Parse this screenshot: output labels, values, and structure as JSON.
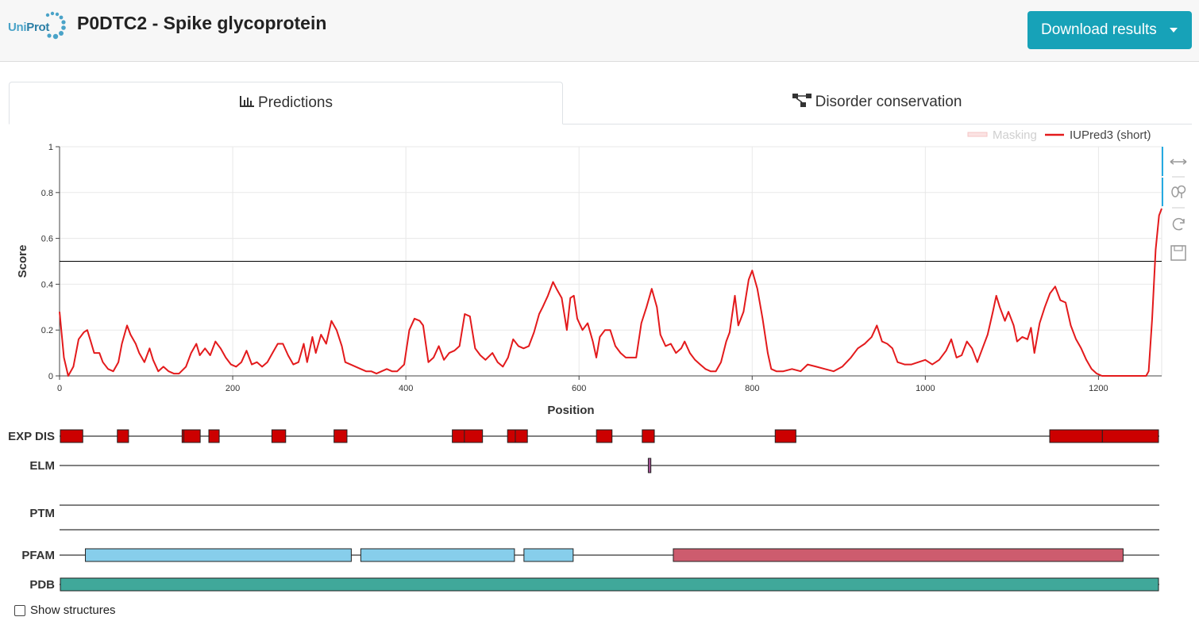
{
  "header": {
    "logo_text_a": "Uni",
    "logo_text_b": "Prot",
    "title": "P0DTC2 - Spike glycoprotein",
    "download_label": "Download results"
  },
  "tabs": [
    {
      "label": "Predictions",
      "icon": "bar-chart-icon",
      "active": true
    },
    {
      "label": "Disorder conservation",
      "icon": "tree-icon",
      "active": false
    }
  ],
  "toolbar": {
    "tools": [
      "pan-icon",
      "wheel-zoom-icon",
      "reset-icon",
      "save-icon"
    ]
  },
  "chart_data": {
    "type": "line",
    "xlabel": "Position",
    "ylabel": "Score",
    "xlim": [
      0,
      1273
    ],
    "ylim": [
      0,
      1
    ],
    "x_ticks": [
      0,
      200,
      400,
      600,
      800,
      1000,
      1200
    ],
    "y_ticks": [
      "0",
      "0.2",
      "0.4",
      "0.6",
      "0.8",
      "1"
    ],
    "threshold": 0.5,
    "legend": [
      {
        "name": "Masking",
        "color": "#f4b8b8",
        "muted": true
      },
      {
        "name": "IUPred3 (short)",
        "color": "#e31a1c",
        "muted": false
      }
    ],
    "series": [
      {
        "name": "IUPred3 (short)",
        "color": "#e31a1c",
        "points": [
          [
            0,
            0.28
          ],
          [
            5,
            0.08
          ],
          [
            10,
            0
          ],
          [
            16,
            0.04
          ],
          [
            22,
            0.16
          ],
          [
            28,
            0.19
          ],
          [
            32,
            0.2
          ],
          [
            36,
            0.15
          ],
          [
            40,
            0.1
          ],
          [
            46,
            0.1
          ],
          [
            50,
            0.06
          ],
          [
            56,
            0.03
          ],
          [
            62,
            0.02
          ],
          [
            68,
            0.06
          ],
          [
            72,
            0.14
          ],
          [
            78,
            0.22
          ],
          [
            82,
            0.18
          ],
          [
            88,
            0.14
          ],
          [
            92,
            0.1
          ],
          [
            98,
            0.06
          ],
          [
            104,
            0.12
          ],
          [
            108,
            0.07
          ],
          [
            114,
            0.02
          ],
          [
            120,
            0.04
          ],
          [
            126,
            0.02
          ],
          [
            132,
            0.01
          ],
          [
            138,
            0.01
          ],
          [
            146,
            0.04
          ],
          [
            152,
            0.1
          ],
          [
            158,
            0.14
          ],
          [
            162,
            0.09
          ],
          [
            168,
            0.12
          ],
          [
            174,
            0.09
          ],
          [
            180,
            0.15
          ],
          [
            186,
            0.12
          ],
          [
            192,
            0.08
          ],
          [
            198,
            0.05
          ],
          [
            204,
            0.04
          ],
          [
            210,
            0.06
          ],
          [
            216,
            0.11
          ],
          [
            222,
            0.05
          ],
          [
            228,
            0.06
          ],
          [
            234,
            0.04
          ],
          [
            240,
            0.06
          ],
          [
            246,
            0.1
          ],
          [
            252,
            0.14
          ],
          [
            258,
            0.14
          ],
          [
            264,
            0.09
          ],
          [
            270,
            0.05
          ],
          [
            276,
            0.06
          ],
          [
            282,
            0.14
          ],
          [
            286,
            0.06
          ],
          [
            292,
            0.17
          ],
          [
            296,
            0.1
          ],
          [
            302,
            0.18
          ],
          [
            308,
            0.14
          ],
          [
            314,
            0.24
          ],
          [
            320,
            0.2
          ],
          [
            326,
            0.13
          ],
          [
            330,
            0.06
          ],
          [
            336,
            0.05
          ],
          [
            342,
            0.04
          ],
          [
            348,
            0.03
          ],
          [
            354,
            0.02
          ],
          [
            360,
            0.02
          ],
          [
            366,
            0.01
          ],
          [
            372,
            0.02
          ],
          [
            378,
            0.03
          ],
          [
            384,
            0.02
          ],
          [
            390,
            0.02
          ],
          [
            398,
            0.05
          ],
          [
            404,
            0.2
          ],
          [
            410,
            0.25
          ],
          [
            416,
            0.24
          ],
          [
            420,
            0.22
          ],
          [
            426,
            0.06
          ],
          [
            432,
            0.08
          ],
          [
            438,
            0.13
          ],
          [
            444,
            0.07
          ],
          [
            450,
            0.1
          ],
          [
            456,
            0.11
          ],
          [
            462,
            0.13
          ],
          [
            468,
            0.27
          ],
          [
            474,
            0.26
          ],
          [
            480,
            0.12
          ],
          [
            486,
            0.09
          ],
          [
            492,
            0.07
          ],
          [
            500,
            0.1
          ],
          [
            506,
            0.06
          ],
          [
            512,
            0.04
          ],
          [
            518,
            0.08
          ],
          [
            524,
            0.16
          ],
          [
            530,
            0.13
          ],
          [
            536,
            0.12
          ],
          [
            542,
            0.13
          ],
          [
            548,
            0.19
          ],
          [
            554,
            0.27
          ],
          [
            558,
            0.3
          ],
          [
            564,
            0.35
          ],
          [
            570,
            0.41
          ],
          [
            574,
            0.38
          ],
          [
            580,
            0.34
          ],
          [
            586,
            0.2
          ],
          [
            590,
            0.34
          ],
          [
            594,
            0.35
          ],
          [
            598,
            0.25
          ],
          [
            604,
            0.2
          ],
          [
            610,
            0.23
          ],
          [
            616,
            0.15
          ],
          [
            620,
            0.08
          ],
          [
            624,
            0.17
          ],
          [
            630,
            0.2
          ],
          [
            636,
            0.2
          ],
          [
            642,
            0.13
          ],
          [
            648,
            0.1
          ],
          [
            654,
            0.08
          ],
          [
            660,
            0.08
          ],
          [
            666,
            0.08
          ],
          [
            672,
            0.23
          ],
          [
            678,
            0.3
          ],
          [
            684,
            0.38
          ],
          [
            690,
            0.3
          ],
          [
            694,
            0.18
          ],
          [
            700,
            0.13
          ],
          [
            706,
            0.14
          ],
          [
            712,
            0.1
          ],
          [
            718,
            0.12
          ],
          [
            722,
            0.15
          ],
          [
            728,
            0.1
          ],
          [
            734,
            0.07
          ],
          [
            740,
            0.05
          ],
          [
            746,
            0.03
          ],
          [
            752,
            0.02
          ],
          [
            758,
            0.02
          ],
          [
            764,
            0.06
          ],
          [
            770,
            0.15
          ],
          [
            774,
            0.19
          ],
          [
            780,
            0.35
          ],
          [
            784,
            0.22
          ],
          [
            790,
            0.28
          ],
          [
            796,
            0.42
          ],
          [
            800,
            0.46
          ],
          [
            806,
            0.38
          ],
          [
            812,
            0.25
          ],
          [
            818,
            0.1
          ],
          [
            822,
            0.03
          ],
          [
            828,
            0.02
          ],
          [
            836,
            0.02
          ],
          [
            846,
            0.03
          ],
          [
            856,
            0.02
          ],
          [
            864,
            0.05
          ],
          [
            874,
            0.04
          ],
          [
            884,
            0.03
          ],
          [
            894,
            0.02
          ],
          [
            904,
            0.04
          ],
          [
            914,
            0.08
          ],
          [
            922,
            0.12
          ],
          [
            930,
            0.14
          ],
          [
            938,
            0.17
          ],
          [
            944,
            0.22
          ],
          [
            950,
            0.15
          ],
          [
            956,
            0.14
          ],
          [
            962,
            0.12
          ],
          [
            968,
            0.06
          ],
          [
            976,
            0.05
          ],
          [
            984,
            0.05
          ],
          [
            992,
            0.06
          ],
          [
            1000,
            0.07
          ],
          [
            1008,
            0.05
          ],
          [
            1016,
            0.07
          ],
          [
            1024,
            0.11
          ],
          [
            1030,
            0.16
          ],
          [
            1036,
            0.08
          ],
          [
            1042,
            0.09
          ],
          [
            1048,
            0.15
          ],
          [
            1054,
            0.12
          ],
          [
            1060,
            0.06
          ],
          [
            1066,
            0.12
          ],
          [
            1072,
            0.18
          ],
          [
            1078,
            0.28
          ],
          [
            1082,
            0.35
          ],
          [
            1086,
            0.3
          ],
          [
            1092,
            0.24
          ],
          [
            1096,
            0.28
          ],
          [
            1102,
            0.22
          ],
          [
            1106,
            0.15
          ],
          [
            1112,
            0.17
          ],
          [
            1118,
            0.16
          ],
          [
            1122,
            0.21
          ],
          [
            1126,
            0.1
          ],
          [
            1132,
            0.23
          ],
          [
            1138,
            0.3
          ],
          [
            1144,
            0.36
          ],
          [
            1150,
            0.39
          ],
          [
            1156,
            0.33
          ],
          [
            1162,
            0.32
          ],
          [
            1168,
            0.22
          ],
          [
            1174,
            0.16
          ],
          [
            1180,
            0.12
          ],
          [
            1186,
            0.07
          ],
          [
            1192,
            0.03
          ],
          [
            1198,
            0.01
          ],
          [
            1204,
            0
          ],
          [
            1220,
            0
          ],
          [
            1240,
            0
          ],
          [
            1255,
            0
          ],
          [
            1258,
            0.02
          ],
          [
            1262,
            0.25
          ],
          [
            1266,
            0.55
          ],
          [
            1270,
            0.7
          ],
          [
            1273,
            0.73
          ]
        ]
      }
    ]
  },
  "tracks": {
    "axis_start": 1,
    "axis_end": 1273,
    "rows": [
      {
        "label": "EXP DIS",
        "features": [
          {
            "start": 1,
            "end": 27,
            "color": "#cc0000"
          },
          {
            "start": 67,
            "end": 80,
            "color": "#cc0000"
          },
          {
            "start": 142,
            "end": 155,
            "color": "#cc0000"
          },
          {
            "start": 144,
            "end": 163,
            "color": "#cc0000"
          },
          {
            "start": 173,
            "end": 185,
            "color": "#cc0000"
          },
          {
            "start": 246,
            "end": 262,
            "color": "#cc0000"
          },
          {
            "start": 318,
            "end": 333,
            "color": "#cc0000"
          },
          {
            "start": 455,
            "end": 470,
            "color": "#cc0000"
          },
          {
            "start": 469,
            "end": 490,
            "color": "#cc0000"
          },
          {
            "start": 519,
            "end": 533,
            "color": "#cc0000"
          },
          {
            "start": 528,
            "end": 542,
            "color": "#cc0000"
          },
          {
            "start": 622,
            "end": 640,
            "color": "#cc0000"
          },
          {
            "start": 675,
            "end": 689,
            "color": "#cc0000"
          },
          {
            "start": 829,
            "end": 853,
            "color": "#cc0000"
          },
          {
            "start": 1147,
            "end": 1208,
            "color": "#cc0000"
          },
          {
            "start": 1208,
            "end": 1273,
            "color": "#cc0000"
          }
        ]
      },
      {
        "label": "ELM",
        "features": [
          {
            "start": 682,
            "end": 685,
            "color": "#a05090"
          }
        ]
      },
      {
        "label": "PTM",
        "features": []
      },
      {
        "label": "PFAM",
        "features": [
          {
            "start": 30,
            "end": 338,
            "color": "#87ceeb"
          },
          {
            "start": 349,
            "end": 527,
            "color": "#87ceeb"
          },
          {
            "start": 538,
            "end": 595,
            "color": "#87ceeb"
          },
          {
            "start": 711,
            "end": 1232,
            "color": "#cd5c6e"
          }
        ]
      },
      {
        "label": "PDB",
        "features": [
          {
            "start": 1,
            "end": 1273,
            "color": "#40a89a"
          }
        ]
      }
    ]
  },
  "show_structures": {
    "label": "Show structures",
    "checked": false
  }
}
